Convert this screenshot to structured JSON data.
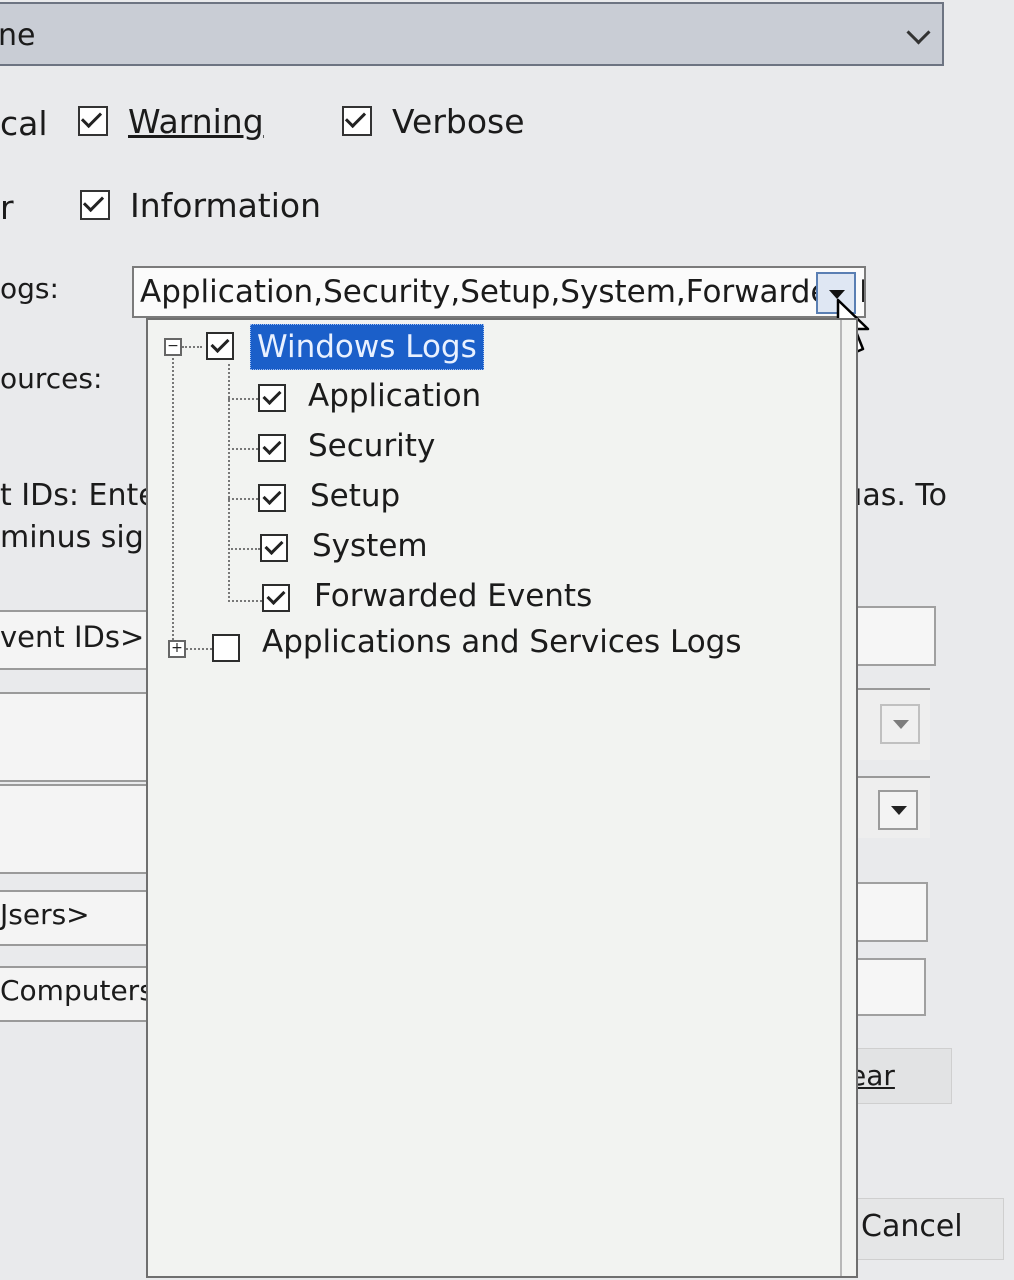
{
  "top_select": {
    "value_fragment": "ne"
  },
  "levels": {
    "critical_fragment": "cal",
    "error_fragment": "r",
    "warning": {
      "label": "Warning",
      "checked": true
    },
    "verbose": {
      "label": "Verbose",
      "checked": true
    },
    "information": {
      "label": "Information",
      "checked": true
    }
  },
  "left_labels": {
    "logs": "ogs:",
    "sources": "ources:",
    "event_ids_line1": "t IDs: Ente",
    "event_ids_line2": "minus sigr",
    "event_ids_placeholder": "vent IDs>",
    "users_placeholder": "Jsers>",
    "computers_placeholder": "Computers"
  },
  "right_labels": {
    "event_ids_hint": "ıas. To",
    "clear_fragment": "ear",
    "cancel": "Cancel"
  },
  "event_logs_combo": {
    "value": "Application,Security,Setup,System,Forwarded E",
    "icon": "chevron-down-icon"
  },
  "log_tree": [
    {
      "label": "Windows Logs",
      "checked": true,
      "expanded": true,
      "selected": true,
      "children": [
        {
          "label": "Application",
          "checked": true
        },
        {
          "label": "Security",
          "checked": true
        },
        {
          "label": "Setup",
          "checked": true
        },
        {
          "label": "System",
          "checked": true
        },
        {
          "label": "Forwarded Events",
          "checked": true
        }
      ]
    },
    {
      "label": "Applications and Services Logs",
      "checked": false,
      "expanded": false
    }
  ],
  "colors": {
    "selection": "#1b5fc9",
    "background": "#e9eaec",
    "popup": "#f2f3f1"
  }
}
